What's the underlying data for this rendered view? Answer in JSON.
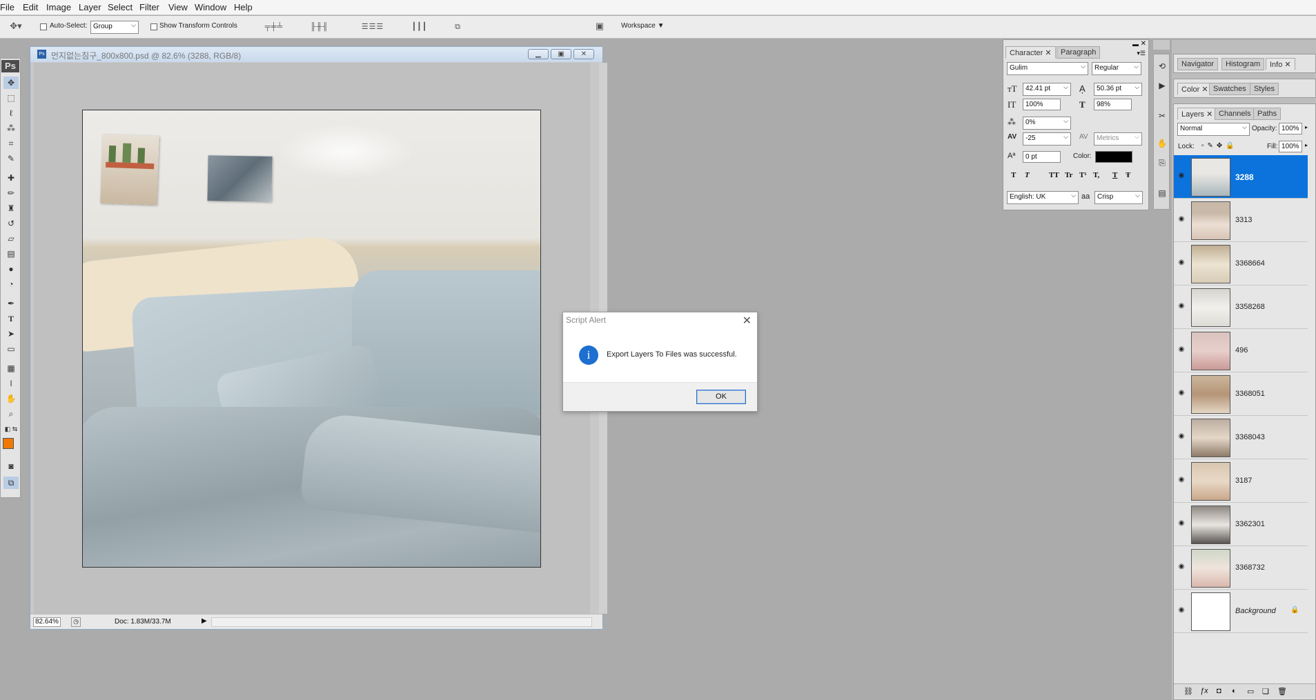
{
  "menu": {
    "items": [
      "File",
      "Edit",
      "Image",
      "Layer",
      "Select",
      "Filter",
      "View",
      "Window",
      "Help"
    ]
  },
  "options_bar": {
    "auto_select_label": "Auto-Select:",
    "auto_select_value": "Group",
    "show_transform_label": "Show Transform Controls",
    "workspace_label": "Workspace ▼"
  },
  "toolbox": {
    "logo": "Ps"
  },
  "document": {
    "title": "먼지없는침구_800x800.psd @ 82.6% (3288, RGB/8)",
    "zoom": "82.64%",
    "doc_info": "Doc: 1.83M/33.7M"
  },
  "alert": {
    "title": "Script Alert",
    "message": "Export Layers To Files was successful.",
    "ok_label": "OK",
    "close_glyph": "✕",
    "info_glyph": "i"
  },
  "character_panel": {
    "tabs": [
      "Character ✕",
      "Paragraph"
    ],
    "font_family": "Gulim",
    "font_style": "Regular",
    "font_size": "42.41 pt",
    "leading": "50.36 pt",
    "vertical_scale": "100%",
    "horizontal_scale": "98%",
    "tsume": "0%",
    "tracking": "-25",
    "kerning": "Metrics",
    "baseline_shift": "0 pt",
    "color_label": "Color:",
    "color_swatch": "#000000",
    "style_buttons": [
      "T",
      "T",
      "TT",
      "Tr",
      "T¹",
      "T,",
      "T",
      "Ŧ"
    ],
    "language": "English: UK",
    "antialias_icon": "aa",
    "antialias": "Crisp"
  },
  "nav_panel": {
    "tabs": [
      "Navigator",
      "Histogram",
      "Info ✕"
    ]
  },
  "color_panel": {
    "tabs": [
      "Color ✕",
      "Swatches",
      "Styles"
    ]
  },
  "layers_panel": {
    "tabs": [
      "Layers ✕",
      "Channels",
      "Paths"
    ],
    "blend_mode": "Normal",
    "opacity_label": "Opacity:",
    "opacity": "100%",
    "lock_label": "Lock:",
    "fill_label": "Fill:",
    "fill": "100%",
    "layers": [
      {
        "name": "3288",
        "selected": true
      },
      {
        "name": "3313",
        "selected": false
      },
      {
        "name": "3368664",
        "selected": false
      },
      {
        "name": "3358268",
        "selected": false
      },
      {
        "name": "496",
        "selected": false
      },
      {
        "name": "3368051",
        "selected": false
      },
      {
        "name": "3368043",
        "selected": false
      },
      {
        "name": "3187",
        "selected": false
      },
      {
        "name": "3362301",
        "selected": false
      },
      {
        "name": "3368732",
        "selected": false
      },
      {
        "name": "Background",
        "selected": false
      }
    ],
    "footer_icons": [
      "link-icon",
      "fx-icon",
      "mask-icon",
      "adjustment-icon",
      "folder-icon",
      "new-layer-icon",
      "trash-icon"
    ]
  },
  "colors": {
    "accent_selection": "#0c73dc",
    "foreground": "#f07800",
    "background": "#000000"
  }
}
